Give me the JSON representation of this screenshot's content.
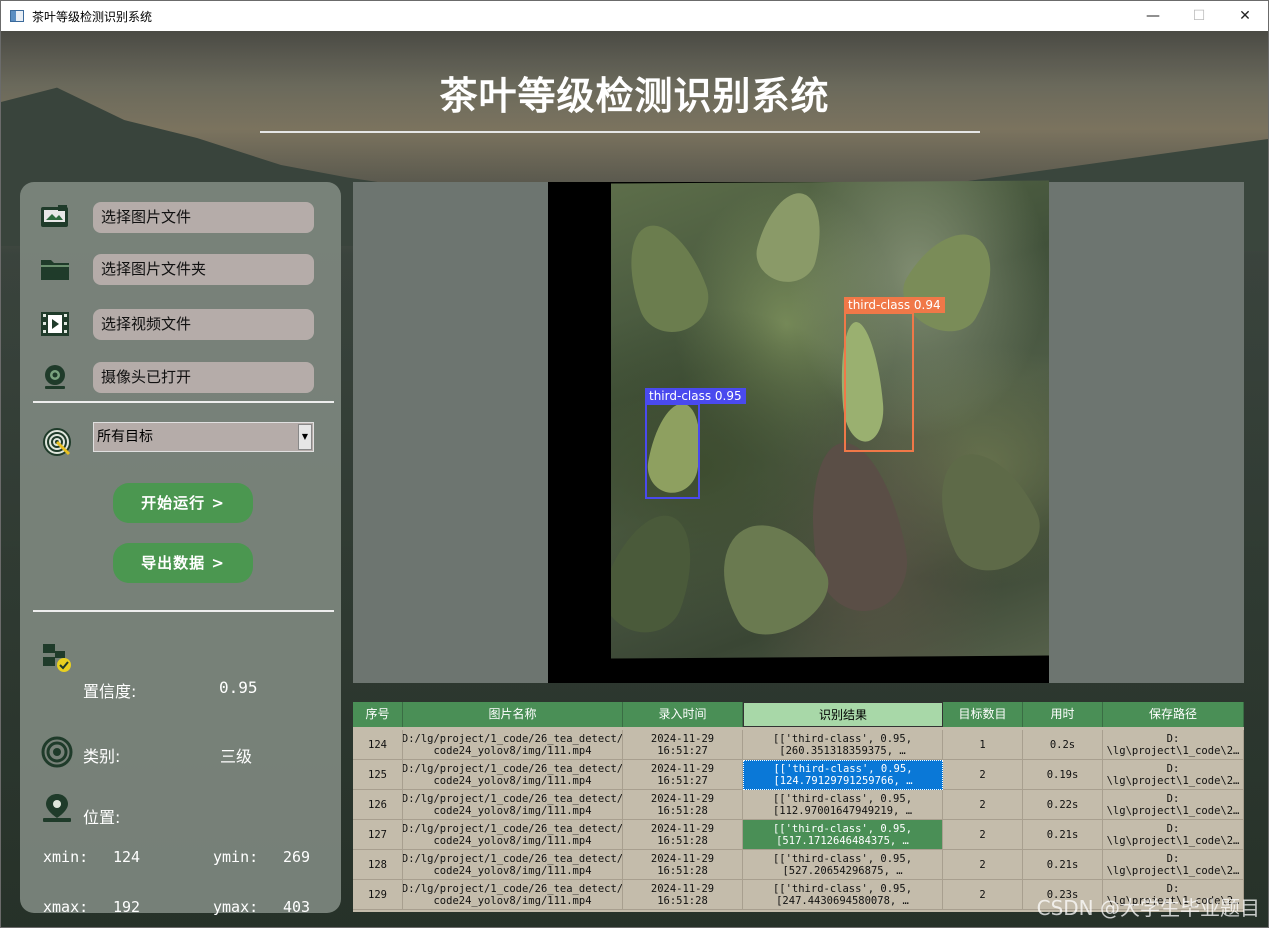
{
  "window": {
    "title": "茶叶等级检测识别系统",
    "controls": {
      "minimize": "—",
      "maximize": "☐",
      "close": "✕"
    }
  },
  "header": {
    "title": "茶叶等级检测识别系统"
  },
  "left_panel": {
    "buttons": [
      {
        "label": "选择图片文件",
        "icon": "image-file-icon"
      },
      {
        "label": "选择图片文件夹",
        "icon": "folder-icon"
      },
      {
        "label": "选择视频文件",
        "icon": "video-file-icon"
      },
      {
        "label": "摄像头已打开",
        "icon": "camera-icon"
      }
    ],
    "target_select": {
      "value": "所有目标",
      "arrow": "▼"
    },
    "run_button": "开始运行 >",
    "export_button": "导出数据 >",
    "confidence": {
      "label": "置信度:",
      "value": "0.95"
    },
    "category": {
      "label": "类别:",
      "value": "三级"
    },
    "position": {
      "label": "位置:"
    },
    "coords": {
      "xmin_label": "xmin:",
      "xmin": "124",
      "ymin_label": "ymin:",
      "ymin": "269",
      "xmax_label": "xmax:",
      "xmax": "192",
      "ymax_label": "ymax:",
      "ymax": "403"
    }
  },
  "display": {
    "detections": [
      {
        "label": "third-class 0.95",
        "color": "#4a4aee"
      },
      {
        "label": "third-class 0.94",
        "color": "#f07848"
      }
    ]
  },
  "table": {
    "headers": [
      "序号",
      "图片名称",
      "录入时间",
      "识别结果",
      "目标数目",
      "用时",
      "保存路径"
    ],
    "rows": [
      {
        "id": "124",
        "name": "D:/lg/project/1_code/26_tea_detect/\ncode24_yolov8/img/111.mp4",
        "time": "2024-11-29\n16:51:27",
        "result": "[['third-class', 0.95,\n[260.351318359375, …",
        "count": "1",
        "elapsed": "0.2s",
        "path": "D:\n\\lg\\project\\1_code\\2…"
      },
      {
        "id": "125",
        "name": "D:/lg/project/1_code/26_tea_detect/\ncode24_yolov8/img/111.mp4",
        "time": "2024-11-29\n16:51:27",
        "result": "[['third-class', 0.95,\n[124.79129791259766, …",
        "count": "2",
        "elapsed": "0.19s",
        "path": "D:\n\\lg\\project\\1_code\\2…"
      },
      {
        "id": "126",
        "name": "D:/lg/project/1_code/26_tea_detect/\ncode24_yolov8/img/111.mp4",
        "time": "2024-11-29\n16:51:28",
        "result": "[['third-class', 0.95,\n[112.97001647949219, …",
        "count": "2",
        "elapsed": "0.22s",
        "path": "D:\n\\lg\\project\\1_code\\2…"
      },
      {
        "id": "127",
        "name": "D:/lg/project/1_code/26_tea_detect/\ncode24_yolov8/img/111.mp4",
        "time": "2024-11-29\n16:51:28",
        "result": "[['third-class', 0.95,\n[517.1712646484375, …",
        "count": "2",
        "elapsed": "0.21s",
        "path": "D:\n\\lg\\project\\1_code\\2…"
      },
      {
        "id": "128",
        "name": "D:/lg/project/1_code/26_tea_detect/\ncode24_yolov8/img/111.mp4",
        "time": "2024-11-29\n16:51:28",
        "result": "[['third-class', 0.95,\n[527.20654296875, …",
        "count": "2",
        "elapsed": "0.21s",
        "path": "D:\n\\lg\\project\\1_code\\2…"
      },
      {
        "id": "129",
        "name": "D:/lg/project/1_code/26_tea_detect/\ncode24_yolov8/img/111.mp4",
        "time": "2024-11-29\n16:51:28",
        "result": "[['third-class', 0.95,\n[247.4430694580078, …",
        "count": "2",
        "elapsed": "0.23s",
        "path": "D:\n\\lg\\project\\1_code\\2…"
      }
    ]
  },
  "watermark": "CSDN @大学生毕业题目",
  "colors": {
    "accent_green": "#4a8f56",
    "button_green": "#4b9750",
    "selection_blue": "#0a78d7"
  }
}
